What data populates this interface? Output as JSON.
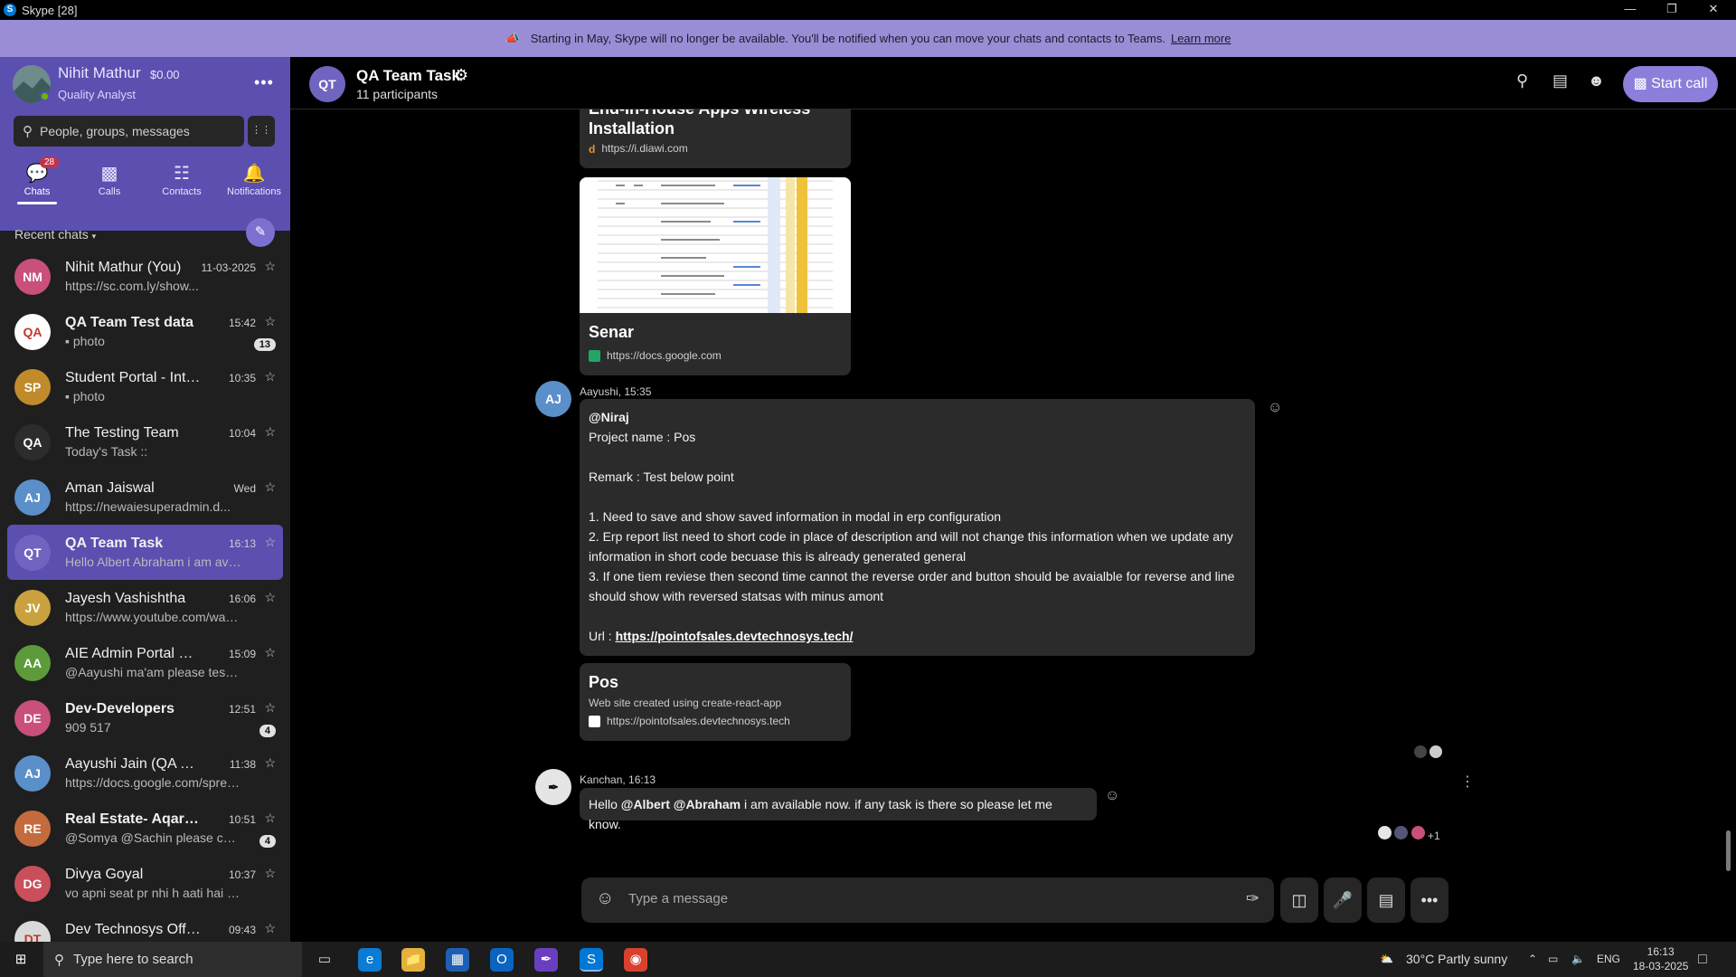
{
  "window": {
    "title": "Skype [28]"
  },
  "banner": {
    "text": "Starting in May, Skype will no longer be available. You'll be notified when you can move your chats and contacts to Teams.",
    "link": "Learn more"
  },
  "profile": {
    "name": "Nihit Mathur",
    "balance": "$0.00",
    "role": "Quality Analyst"
  },
  "search": {
    "placeholder": "People, groups, messages"
  },
  "nav": {
    "chats": "Chats",
    "chats_badge": "28",
    "calls": "Calls",
    "contacts": "Contacts",
    "notifications": "Notifications"
  },
  "recent_label": "Recent chats",
  "chats": [
    {
      "initials": "NM",
      "name": "Nihit Mathur (You)",
      "preview": "https://sc.com.ly/show...",
      "time": "11-03-2025",
      "count": "",
      "color": "#c94f7c",
      "bold": false
    },
    {
      "initials": "QA",
      "name": "QA Team Test data",
      "preview": "▪ photo",
      "time": "15:42",
      "count": "13",
      "color": "#ffffff",
      "bold": true
    },
    {
      "initials": "SP",
      "name": "Student Portal - Intern...",
      "preview": "▪ photo",
      "time": "10:35",
      "count": "",
      "color": "#c18a2b",
      "bold": false
    },
    {
      "initials": "QA",
      "name": "The Testing Team",
      "preview": "Today's Task ::",
      "time": "10:04",
      "count": "",
      "color": "#2c2c2c",
      "bold": false
    },
    {
      "initials": "AJ",
      "name": "Aman Jaiswal",
      "preview": "https://newaiesuperadmin.d...",
      "time": "Wed",
      "count": "",
      "color": "#5a8fc9",
      "bold": false
    },
    {
      "initials": "QT",
      "name": "QA Team Task",
      "preview": "Hello Albert Abraham i am availat",
      "time": "16:13",
      "count": "",
      "color": "#6f65c0",
      "bold": true
    },
    {
      "initials": "JV",
      "name": "Jayesh Vashishtha",
      "preview": "https://www.youtube.com/watc...",
      "time": "16:06",
      "count": "",
      "color": "#c9a23f",
      "bold": false
    },
    {
      "initials": "AA",
      "name": "AIE Admin Portal DEV",
      "preview": "@Aayushi ma'am please test th...",
      "time": "15:09",
      "count": "",
      "color": "#5d9b3a",
      "bold": false
    },
    {
      "initials": "DE",
      "name": "Dev-Developers",
      "preview": "909 517",
      "time": "12:51",
      "count": "4",
      "color": "#c94f7c",
      "bold": true
    },
    {
      "initials": "AJ",
      "name": "Aayushi Jain (QA Team)",
      "preview": "https://docs.google.com/sprea...",
      "time": "11:38",
      "count": "",
      "color": "#5a8fc9",
      "bold": false
    },
    {
      "initials": "RE",
      "name": "Real Estate- Aqarize",
      "preview": "@Somya @Sachin please come",
      "time": "10:51",
      "count": "4",
      "color": "#c46b3e",
      "bold": true
    },
    {
      "initials": "DG",
      "name": "Divya Goyal",
      "preview": "vo apni seat pr nhi h aati hai tb ...",
      "time": "10:37",
      "count": "",
      "color": "#c94f5a",
      "bold": false
    },
    {
      "initials": "DT",
      "name": "Dev Technosys Official Gr...",
      "preview": "",
      "time": "09:43",
      "count": "",
      "color": "#d9d9d9",
      "bold": false
    }
  ],
  "conversation": {
    "initials": "QT",
    "name": "QA Team Task",
    "participants": "11 participants",
    "start_call": "Start call",
    "card1": {
      "title": "Installation",
      "title_top": "End-In-House Apps Wireless",
      "url": "https://i.diawi.com"
    },
    "card2": {
      "title": "Senar",
      "url": "https://docs.google.com"
    },
    "msg1": {
      "initials": "AJ",
      "sender": "Aayushi, 15:35",
      "mention": "@Niraj",
      "lines": [
        "Project name : Pos",
        "",
        "Remark : Test below point",
        "",
        "1. Need to save and show saved information in modal in erp configuration",
        "2. Erp report list need to short code in place of description and will not change this information when we update any",
        "information in short code becuase this is already generated general",
        "3. If one tiem reviese then second time cannot the reverse order and button should be avaialble for reverse and line",
        "should show with reversed statsas with minus amont",
        ""
      ],
      "url_label": "Url : ",
      "url": "https://pointofsales.devtechnosys.tech/"
    },
    "card3": {
      "title": "Pos",
      "desc": "Web site created using create-react-app",
      "url": "https://pointofsales.devtechnosys.tech"
    },
    "msg2": {
      "sender": "Kanchan, 16:13",
      "pre": "Hello ",
      "mention1": "@Albert",
      "mention2": "@Abraham",
      "post": " i am available now. if any task is there so please let me know.",
      "readers_extra": "+1"
    },
    "input_placeholder": "Type a message"
  },
  "taskbar": {
    "search": "Type here to search",
    "weather": "30°C  Partly sunny",
    "lang": "ENG",
    "time": "16:13",
    "date": "18-03-2025"
  }
}
